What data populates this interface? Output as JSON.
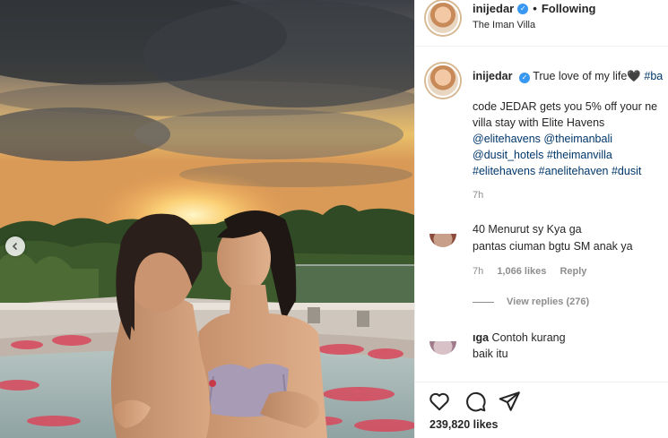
{
  "post": {
    "username": "inijedar",
    "follow_label": "Following",
    "location": "The Iman Villa",
    "caption_first": "True love of my life🖤",
    "caption_first_tag": "#ba",
    "caption_lines": [
      "code JEDAR gets you 5% off your ne",
      "villa stay with Elite Havens",
      "@elitehavens @theimanbali",
      "@dusit_hotels #theimanvilla",
      "#elitehavens #anelitehaven #dusit"
    ],
    "caption_time": "7h",
    "likes": "239,820 likes"
  },
  "comments": [
    {
      "text_line1": "40 Menurut sy Kya ga",
      "text_line2": "pantas ciuman bgtu SM anak ya",
      "time": "7h",
      "likes": "1,066 likes",
      "reply_label": "Reply",
      "view_replies": "View replies (276)"
    },
    {
      "text_line1_bold": "ıga",
      "text_line1": "Contoh kurang",
      "text_line2": "baik itu"
    }
  ],
  "icons": {
    "verified": "verified-badge-icon",
    "carousel_prev": "chevron-left-icon",
    "like": "heart-icon",
    "comment": "comment-bubble-icon",
    "share": "paper-plane-icon"
  },
  "colors": {
    "link": "#00376b",
    "muted": "#8e8e8e",
    "verified": "#3897f0"
  }
}
